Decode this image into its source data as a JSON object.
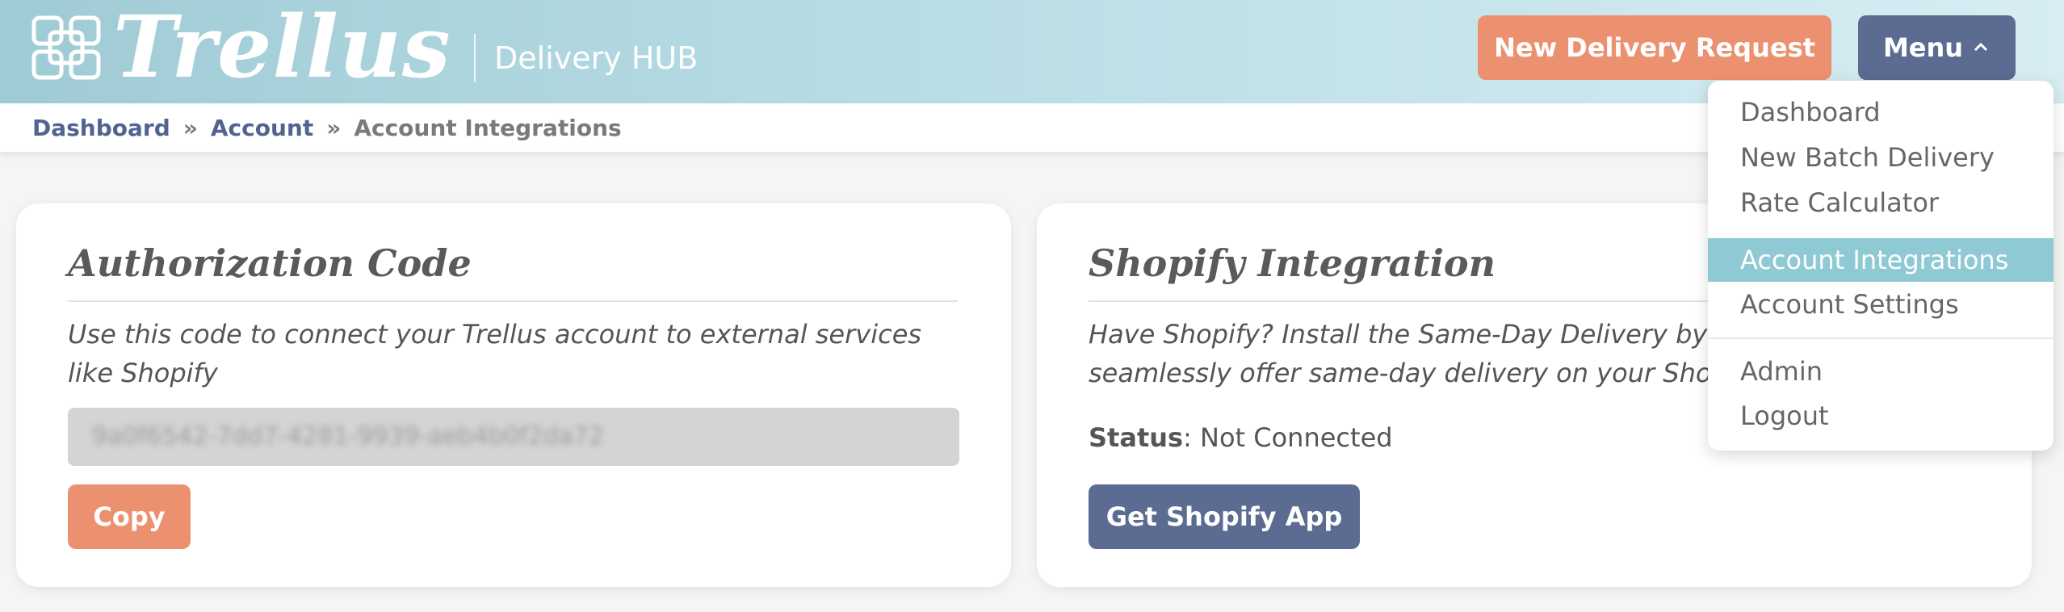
{
  "header": {
    "brand": "Trellus",
    "subtitle": "Delivery HUB",
    "new_request_label": "New Delivery Request",
    "menu_label": "Menu",
    "colors": {
      "accent_orange": "#ec9170",
      "accent_navy": "#5b6b91",
      "teal": "#9fcbd5"
    }
  },
  "breadcrumb": {
    "items": [
      "Dashboard",
      "Account",
      "Account Integrations"
    ],
    "separator": "»"
  },
  "auth_card": {
    "title": "Authorization Code",
    "description": "Use this code to connect your Trellus account to external services like Shopify",
    "code_value": "9a0f6542-7dd7-4281-9939-aeb4b0f2da72",
    "copy_label": "Copy"
  },
  "shopify_card": {
    "title": "Shopify Integration",
    "description": "Have Shopify? Install the Same-Day Delivery by Trellus app to seamlessly offer same-day delivery on your Shopify store.",
    "status_label": "Status",
    "status_value": ": Not Connected",
    "button_label": "Get Shopify App"
  },
  "menu": {
    "items": [
      {
        "label": "Dashboard"
      },
      {
        "label": "New Batch Delivery"
      },
      {
        "label": "Rate Calculator"
      },
      {
        "label": "Account Integrations",
        "active": true
      },
      {
        "label": "Account Settings"
      },
      {
        "label": "Admin"
      },
      {
        "label": "Logout"
      }
    ]
  }
}
